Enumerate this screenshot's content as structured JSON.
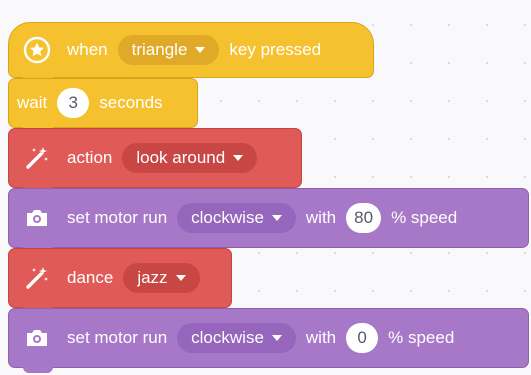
{
  "colors": {
    "event": "#f6c12e",
    "action": "#e05a57",
    "motor": "#a878c8",
    "canvas": "#f9f9fb"
  },
  "blocks": [
    {
      "type": "event",
      "icon": "star-circle-icon",
      "prefix": "when",
      "dropdown": "triangle",
      "suffix": "key pressed"
    },
    {
      "type": "wait",
      "prefix": "wait",
      "value": "3",
      "suffix": "seconds"
    },
    {
      "type": "action",
      "icon": "magic-wand-icon",
      "prefix": "action",
      "dropdown": "look around"
    },
    {
      "type": "motor",
      "icon": "camera-icon",
      "prefix": "set motor run",
      "dropdown": "clockwise",
      "mid": "with",
      "value": "80",
      "suffix": "% speed"
    },
    {
      "type": "action",
      "icon": "magic-wand-icon",
      "prefix": "dance",
      "dropdown": "jazz"
    },
    {
      "type": "motor",
      "icon": "camera-icon",
      "prefix": "set motor run",
      "dropdown": "clockwise",
      "mid": "with",
      "value": "0",
      "suffix": "% speed"
    }
  ]
}
